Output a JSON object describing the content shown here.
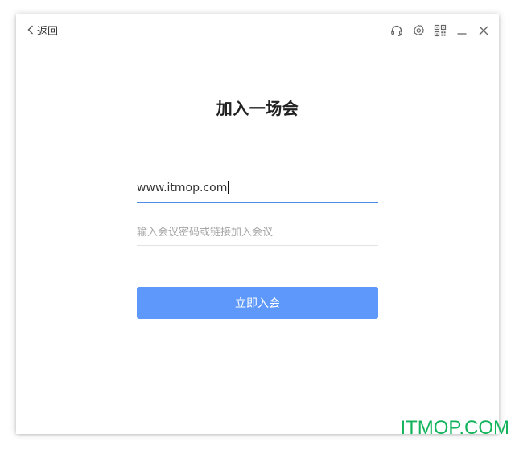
{
  "titlebar": {
    "back_label": "返回",
    "icons": [
      "headset-icon",
      "gear-icon",
      "qr-code-icon",
      "minimize-icon",
      "close-icon"
    ]
  },
  "dialog": {
    "title": "加入一场会",
    "meeting_field": {
      "value": "www.itmop.com",
      "placeholder": ""
    },
    "password_field": {
      "value": "",
      "placeholder": "输入会议密码或链接加入会议"
    },
    "join_button_label": "立即入会"
  },
  "watermark": "ITMOP.COM",
  "colors": {
    "accent": "#5e98fa",
    "input_active_underline": "#4d8fe8",
    "input_underline": "#e3e3e3",
    "watermark": "#13b35c"
  }
}
